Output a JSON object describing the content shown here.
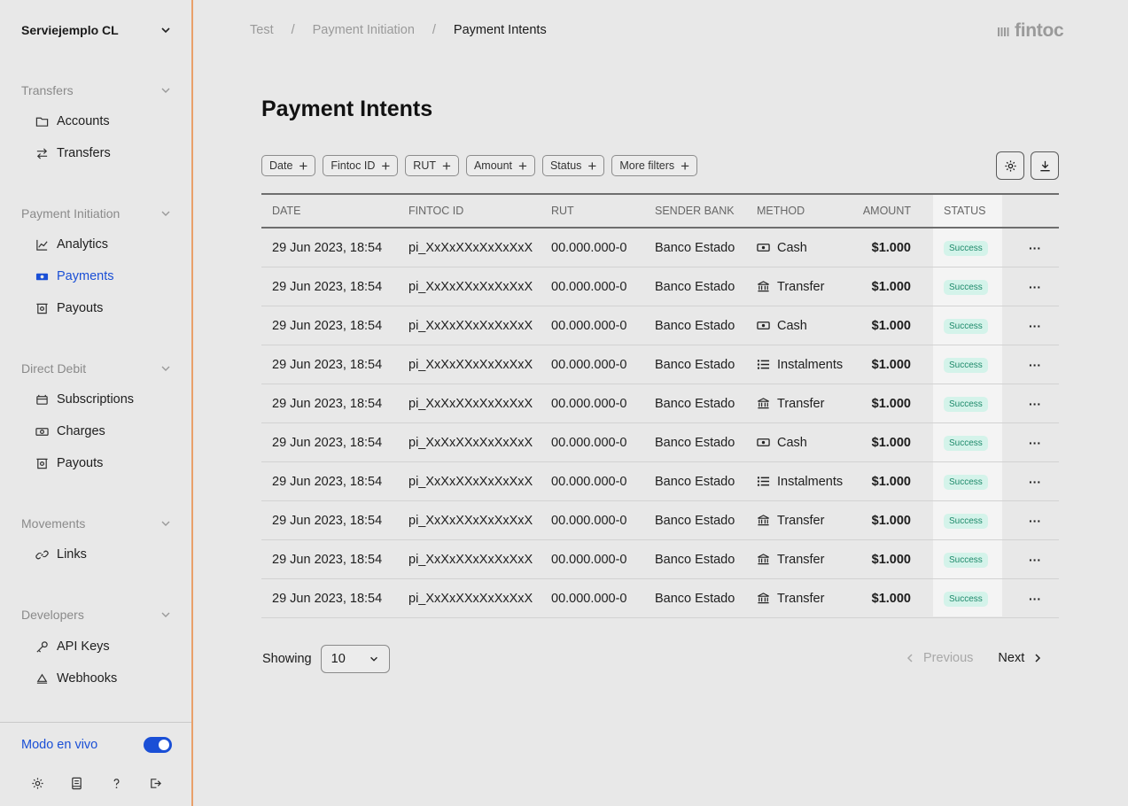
{
  "sidebar": {
    "org": "Serviejemplo CL",
    "sections": [
      {
        "title": "Transfers",
        "items": [
          {
            "label": "Accounts",
            "icon": "folder-icon"
          },
          {
            "label": "Transfers",
            "icon": "swap-icon"
          }
        ]
      },
      {
        "title": "Payment Initiation",
        "items": [
          {
            "label": "Analytics",
            "icon": "chart-line-icon"
          },
          {
            "label": "Payments",
            "icon": "cash-icon"
          },
          {
            "label": "Payouts",
            "icon": "payout-icon"
          }
        ]
      },
      {
        "title": "Direct Debit",
        "items": [
          {
            "label": "Subscriptions",
            "icon": "calendar-icon"
          },
          {
            "label": "Charges",
            "icon": "cash-icon"
          },
          {
            "label": "Payouts",
            "icon": "payout-icon"
          }
        ]
      },
      {
        "title": "Movements",
        "items": [
          {
            "label": "Links",
            "icon": "link-icon"
          }
        ]
      },
      {
        "title": "Developers",
        "items": [
          {
            "label": "API Keys",
            "icon": "key-icon"
          },
          {
            "label": "Webhooks",
            "icon": "webhook-icon"
          }
        ]
      }
    ],
    "live_mode_label": "Modo en vivo",
    "live_mode_on": true
  },
  "breadcrumb": [
    "Test",
    "Payment Initiation",
    "Payment Intents"
  ],
  "logo": "fintoc",
  "page_title": "Payment Intents",
  "filters": [
    "Date",
    "Fintoc ID",
    "RUT",
    "Amount",
    "Status",
    "More filters"
  ],
  "table": {
    "columns": [
      "DATE",
      "FINTOC ID",
      "RUT",
      "SENDER BANK",
      "METHOD",
      "AMOUNT",
      "STATUS"
    ],
    "rows": [
      {
        "date": "29 Jun 2023, 18:54",
        "id": "pi_XxXxXXxXxXxXxX",
        "rut": "00.000.000-0",
        "bank": "Banco Estado",
        "method": "Cash",
        "method_icon": "cash-icon",
        "amount": "$1.000",
        "status": "Success"
      },
      {
        "date": "29 Jun 2023, 18:54",
        "id": "pi_XxXxXXxXxXxXxX",
        "rut": "00.000.000-0",
        "bank": "Banco Estado",
        "method": "Transfer",
        "method_icon": "bank-icon",
        "amount": "$1.000",
        "status": "Success"
      },
      {
        "date": "29 Jun 2023, 18:54",
        "id": "pi_XxXxXXxXxXxXxX",
        "rut": "00.000.000-0",
        "bank": "Banco Estado",
        "method": "Cash",
        "method_icon": "cash-icon",
        "amount": "$1.000",
        "status": "Success"
      },
      {
        "date": "29 Jun 2023, 18:54",
        "id": "pi_XxXxXXxXxXxXxX",
        "rut": "00.000.000-0",
        "bank": "Banco Estado",
        "method": "Instalments",
        "method_icon": "list-icon",
        "amount": "$1.000",
        "status": "Success"
      },
      {
        "date": "29 Jun 2023, 18:54",
        "id": "pi_XxXxXXxXxXxXxX",
        "rut": "00.000.000-0",
        "bank": "Banco Estado",
        "method": "Transfer",
        "method_icon": "bank-icon",
        "amount": "$1.000",
        "status": "Success"
      },
      {
        "date": "29 Jun 2023, 18:54",
        "id": "pi_XxXxXXxXxXxXxX",
        "rut": "00.000.000-0",
        "bank": "Banco Estado",
        "method": "Cash",
        "method_icon": "cash-icon",
        "amount": "$1.000",
        "status": "Success"
      },
      {
        "date": "29 Jun 2023, 18:54",
        "id": "pi_XxXxXXxXxXxXxX",
        "rut": "00.000.000-0",
        "bank": "Banco Estado",
        "method": "Instalments",
        "method_icon": "list-icon",
        "amount": "$1.000",
        "status": "Success"
      },
      {
        "date": "29 Jun 2023, 18:54",
        "id": "pi_XxXxXXxXxXxXxX",
        "rut": "00.000.000-0",
        "bank": "Banco Estado",
        "method": "Transfer",
        "method_icon": "bank-icon",
        "amount": "$1.000",
        "status": "Success"
      },
      {
        "date": "29 Jun 2023, 18:54",
        "id": "pi_XxXxXXxXxXxXxX",
        "rut": "00.000.000-0",
        "bank": "Banco Estado",
        "method": "Transfer",
        "method_icon": "bank-icon",
        "amount": "$1.000",
        "status": "Success"
      },
      {
        "date": "29 Jun 2023, 18:54",
        "id": "pi_XxXxXXxXxXxXxX",
        "rut": "00.000.000-0",
        "bank": "Banco Estado",
        "method": "Transfer",
        "method_icon": "bank-icon",
        "amount": "$1.000",
        "status": "Success"
      }
    ]
  },
  "pagination": {
    "showing_label": "Showing",
    "page_size": "10",
    "previous": "Previous",
    "next": "Next"
  },
  "colors": {
    "accent": "#1a4fd6",
    "sidebar_border": "#e9a06a",
    "success_bg": "#d4f3ea",
    "success_text": "#1f8a6b"
  }
}
